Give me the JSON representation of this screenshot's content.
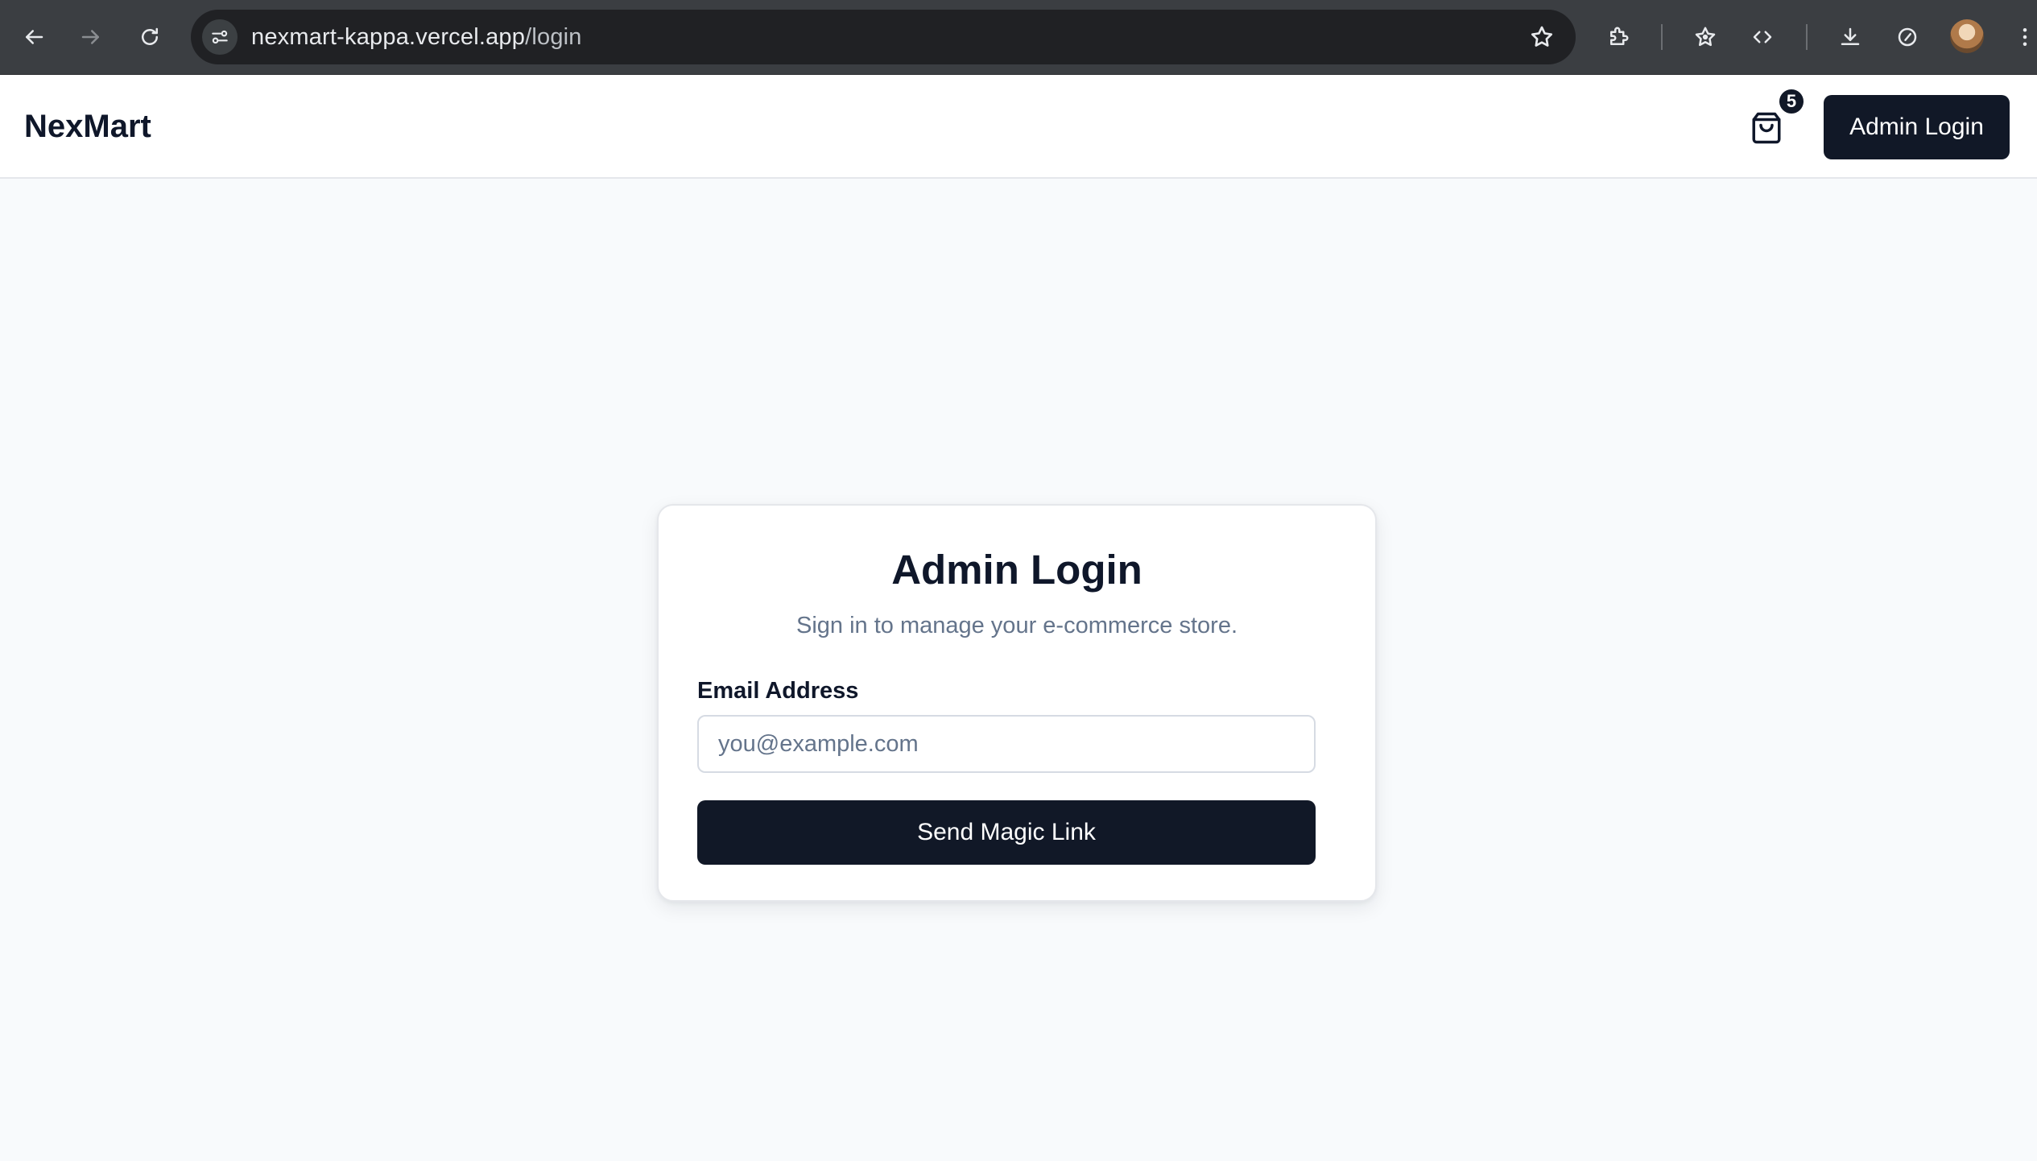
{
  "browser": {
    "url_host": "nexmart-kappa.vercel.app",
    "url_path": "/login",
    "icons": {
      "back": "back-arrow-icon",
      "forward": "forward-arrow-icon",
      "reload": "reload-icon",
      "site_info": "tune-icon",
      "bookmark": "star-icon",
      "extensions": "puzzle-icon",
      "reading_list": "star-list-icon",
      "devtools": "code-icon",
      "downloads": "download-icon",
      "performance": "speedometer-icon",
      "profile": "avatar",
      "menu": "kebab-menu-icon"
    }
  },
  "header": {
    "brand": "NexMart",
    "cart_count": "5",
    "admin_button": "Admin Login"
  },
  "login": {
    "title": "Admin Login",
    "subtitle": "Sign in to manage your e-commerce store.",
    "email_label": "Email Address",
    "email_placeholder": "you@example.com",
    "email_value": "",
    "submit_label": "Send Magic Link"
  },
  "colors": {
    "primary": "#111827",
    "page_bg": "#f8fafc",
    "muted_text": "#64748b",
    "chrome_bg": "#3b3e42"
  }
}
